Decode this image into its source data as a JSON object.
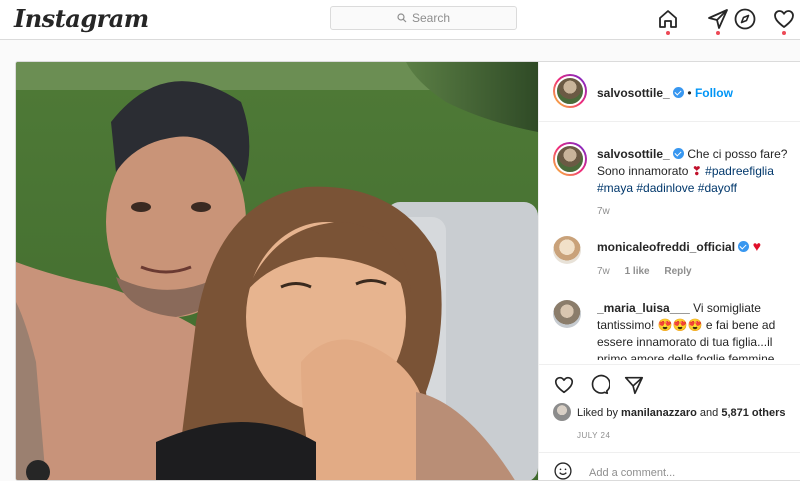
{
  "header": {
    "logo": "Instagram",
    "search_placeholder": "Search"
  },
  "post": {
    "author": "salvosottile_",
    "follow_label": "Follow",
    "caption": {
      "text": "Che ci posso fare? Sono innamorato",
      "hashtags": [
        "#padreefiglia",
        "#maya",
        "#dadinlove",
        "#dayoff"
      ],
      "age": "7w"
    },
    "comments": [
      {
        "user": "monicaleofreddi_official",
        "text": "",
        "age": "7w",
        "likes": "1 like",
        "reply_label": "Reply"
      },
      {
        "user": "_maria_luisa___",
        "text_part1": "Vi somigliate tantissimo!",
        "text_part2": "e fai bene ad essere innamorato di tua figlia...il primo amore delle foglie femmine"
      }
    ],
    "liked_by_prefix": "Liked by",
    "liked_by_user": "manilanazzaro",
    "liked_by_and": "and",
    "liked_by_count": "5,871 others",
    "date": "JULY 24",
    "add_comment_placeholder": "Add a comment..."
  },
  "colors": {
    "link": "#0095f6",
    "hashtag": "#00376b",
    "notification_dot": "#ed4956",
    "border": "#dbdbdb"
  }
}
